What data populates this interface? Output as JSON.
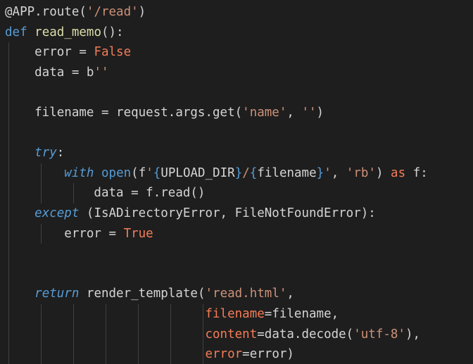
{
  "editor": {
    "language": "python",
    "colors": {
      "background": "#1e1e1e",
      "text": "#d4d4d4",
      "keyword": "#569cd6",
      "function": "#dcdcaa",
      "string": "#ce9178",
      "constant": "#f47c58",
      "indent_guide": "#404040"
    },
    "lines": [
      [
        {
          "t": "@APP.route(",
          "c": "deco"
        },
        {
          "t": "'/read'",
          "c": "str"
        },
        {
          "t": ")",
          "c": "punc"
        }
      ],
      [
        {
          "t": "def",
          "c": "kw"
        },
        {
          "t": " ",
          "c": "plain"
        },
        {
          "t": "read_memo",
          "c": "fn"
        },
        {
          "t": "():",
          "c": "punc"
        }
      ],
      [
        {
          "t": "    error = ",
          "c": "plain"
        },
        {
          "t": "False",
          "c": "const"
        }
      ],
      [
        {
          "t": "    data = b",
          "c": "plain"
        },
        {
          "t": "''",
          "c": "str"
        }
      ],
      [],
      [
        {
          "t": "    filename = request.args.get(",
          "c": "plain"
        },
        {
          "t": "'name'",
          "c": "str"
        },
        {
          "t": ", ",
          "c": "punc"
        },
        {
          "t": "''",
          "c": "str"
        },
        {
          "t": ")",
          "c": "punc"
        }
      ],
      [],
      [
        {
          "t": "    ",
          "c": "plain"
        },
        {
          "t": "try",
          "c": "ctrl"
        },
        {
          "t": ":",
          "c": "punc"
        }
      ],
      [
        {
          "t": "        ",
          "c": "plain"
        },
        {
          "t": "with",
          "c": "ctrl"
        },
        {
          "t": " ",
          "c": "plain"
        },
        {
          "t": "open",
          "c": "kw"
        },
        {
          "t": "(",
          "c": "punc"
        },
        {
          "t": "f",
          "c": "plain"
        },
        {
          "t": "'",
          "c": "str"
        },
        {
          "t": "{",
          "c": "brace"
        },
        {
          "t": "UPLOAD_DIR",
          "c": "plain"
        },
        {
          "t": "}",
          "c": "brace"
        },
        {
          "t": "/",
          "c": "str"
        },
        {
          "t": "{",
          "c": "brace"
        },
        {
          "t": "filename",
          "c": "plain"
        },
        {
          "t": "}",
          "c": "brace"
        },
        {
          "t": "'",
          "c": "str"
        },
        {
          "t": ", ",
          "c": "punc"
        },
        {
          "t": "'rb'",
          "c": "str"
        },
        {
          "t": ") ",
          "c": "punc"
        },
        {
          "t": "as",
          "c": "const"
        },
        {
          "t": " f:",
          "c": "plain"
        }
      ],
      [
        {
          "t": "            data = f.read()",
          "c": "plain"
        }
      ],
      [
        {
          "t": "    ",
          "c": "plain"
        },
        {
          "t": "except",
          "c": "ctrl"
        },
        {
          "t": " (IsADirectoryError, FileNotFoundError):",
          "c": "plain"
        }
      ],
      [
        {
          "t": "        error = ",
          "c": "plain"
        },
        {
          "t": "True",
          "c": "const"
        }
      ],
      [],
      [],
      [
        {
          "t": "    ",
          "c": "plain"
        },
        {
          "t": "return",
          "c": "ctrl"
        },
        {
          "t": " render_template(",
          "c": "plain"
        },
        {
          "t": "'read.html'",
          "c": "str"
        },
        {
          "t": ",",
          "c": "punc"
        }
      ],
      [
        {
          "t": "                           ",
          "c": "plain"
        },
        {
          "t": "filename",
          "c": "kwarg"
        },
        {
          "t": "=filename,",
          "c": "plain"
        }
      ],
      [
        {
          "t": "                           ",
          "c": "plain"
        },
        {
          "t": "content",
          "c": "kwarg"
        },
        {
          "t": "=data.decode(",
          "c": "plain"
        },
        {
          "t": "'utf-8'",
          "c": "str"
        },
        {
          "t": "),",
          "c": "punc"
        }
      ],
      [
        {
          "t": "                           ",
          "c": "plain"
        },
        {
          "t": "error",
          "c": "kwarg"
        },
        {
          "t": "=error)",
          "c": "plain"
        }
      ]
    ]
  }
}
